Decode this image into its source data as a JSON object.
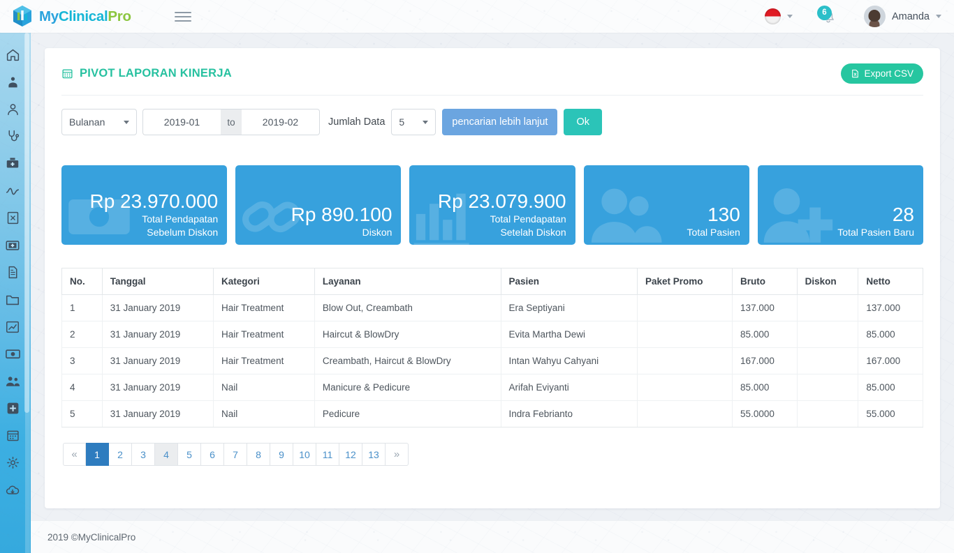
{
  "header": {
    "brand": {
      "part1": "My",
      "part2": "Clinical",
      "part3": "Pro"
    },
    "menu_icon": "hamburger-icon",
    "language_flag": "indonesia-flag-icon",
    "notification_count": "6",
    "user_name": "Amanda"
  },
  "sidebar": {
    "items": [
      {
        "icon": "home-icon",
        "name": "sidebar-item-home"
      },
      {
        "icon": "doctor-icon",
        "name": "sidebar-item-doctor"
      },
      {
        "icon": "user-icon",
        "name": "sidebar-item-patient"
      },
      {
        "icon": "stethoscope-icon",
        "name": "sidebar-item-consultation"
      },
      {
        "icon": "medical-bag-icon",
        "name": "sidebar-item-medical-bag"
      },
      {
        "icon": "pulse-icon",
        "name": "sidebar-item-vitals"
      },
      {
        "icon": "excel-file-icon",
        "name": "sidebar-item-reports"
      },
      {
        "icon": "first-aid-kit-icon",
        "name": "sidebar-item-first-aid"
      },
      {
        "icon": "document-icon",
        "name": "sidebar-item-documents"
      },
      {
        "icon": "folder-icon",
        "name": "sidebar-item-folders"
      },
      {
        "icon": "chart-growth-icon",
        "name": "sidebar-item-analytics"
      },
      {
        "icon": "money-icon",
        "name": "sidebar-item-finance"
      },
      {
        "icon": "users-group-icon",
        "name": "sidebar-item-staff"
      },
      {
        "icon": "add-plus-icon",
        "name": "sidebar-item-add"
      },
      {
        "icon": "calendar-icon",
        "name": "sidebar-item-calendar"
      },
      {
        "icon": "gear-icon",
        "name": "sidebar-item-settings"
      },
      {
        "icon": "cloud-download-icon",
        "name": "sidebar-item-backup"
      }
    ]
  },
  "panel": {
    "title": "PIVOT LAPORAN KINERJA",
    "title_icon": "calendar-icon",
    "export_label": "Export CSV",
    "export_icon": "csv-file-icon"
  },
  "filters": {
    "period": "Bulanan",
    "date_from": "2019-01",
    "date_to": "2019-02",
    "separator": "to",
    "count_label": "Jumlah Data",
    "count_value": "5",
    "advanced_button": "pencarian lebih lanjut",
    "ok_button": "Ok"
  },
  "cards": [
    {
      "value": "Rp 23.970.000",
      "label": "Total Pendapatan Sebelum Diskon",
      "icon": "money-bill-icon"
    },
    {
      "value": "Rp 890.100",
      "label": "Diskon",
      "icon": "discount-tag-icon"
    },
    {
      "value": "Rp 23.079.900",
      "label": "Total Pendapatan Setelah Diskon",
      "icon": "bar-chart-icon"
    },
    {
      "value": "130",
      "label": "Total Pasien",
      "icon": "users-group-icon"
    },
    {
      "value": "28",
      "label": "Total Pasien Baru",
      "icon": "user-plus-icon"
    }
  ],
  "card_color": "#37a1dd",
  "accent_color": "#26c6a0",
  "table": {
    "columns": [
      "No.",
      "Tanggal",
      "Kategori",
      "Layanan",
      "Pasien",
      "Paket Promo",
      "Bruto",
      "Diskon",
      "Netto"
    ],
    "rows": [
      [
        "1",
        "31 January 2019",
        "Hair Treatment",
        "Blow Out, Creambath",
        "Era Septiyani",
        "",
        "137.000",
        "",
        "137.000"
      ],
      [
        "2",
        "31 January 2019",
        "Hair Treatment",
        "Haircut & BlowDry",
        "Evita Martha Dewi",
        "",
        "85.000",
        "",
        "85.000"
      ],
      [
        "3",
        "31 January 2019",
        "Hair Treatment",
        "Creambath, Haircut & BlowDry",
        "Intan Wahyu Cahyani",
        "",
        "167.000",
        "",
        "167.000"
      ],
      [
        "4",
        "31 January 2019",
        "Nail",
        "Manicure & Pedicure",
        "Arifah Eviyanti",
        "",
        "85.000",
        "",
        "85.000"
      ],
      [
        "5",
        "31 January 2019",
        "Nail",
        "Pedicure",
        "Indra Febrianto",
        "",
        "55.0000",
        "",
        "55.000"
      ]
    ]
  },
  "pagination": {
    "prev": "«",
    "next": "»",
    "pages": [
      "1",
      "2",
      "3",
      "4",
      "5",
      "6",
      "7",
      "8",
      "9",
      "10",
      "11",
      "12",
      "13"
    ],
    "active": "1",
    "hovered": "4"
  },
  "footer": {
    "text": "2019 ©MyClinicalPro"
  }
}
